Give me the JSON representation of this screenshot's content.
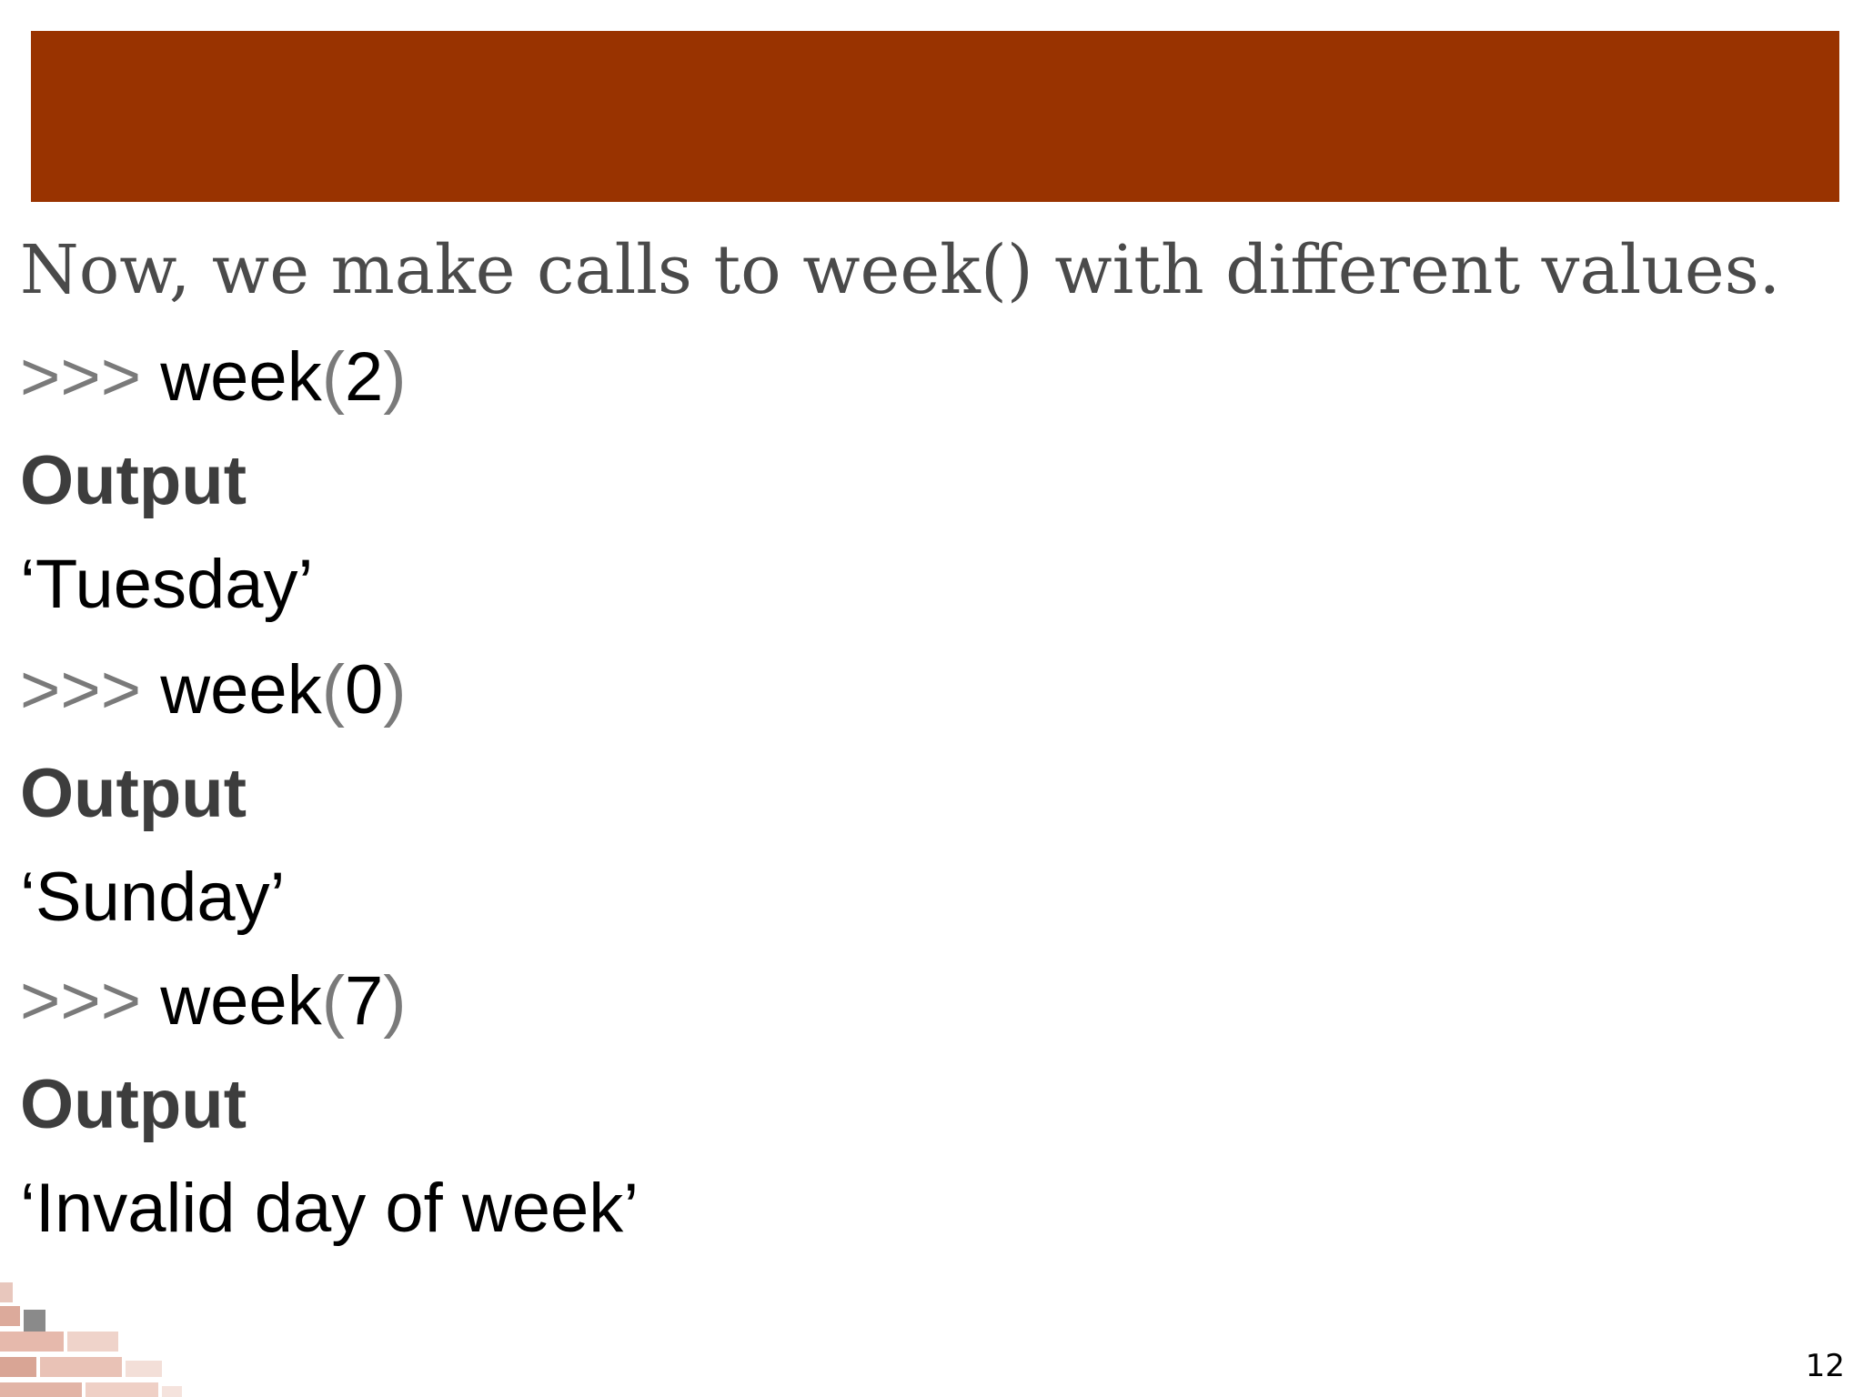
{
  "colors": {
    "title_bar": "#993300",
    "prompt": "#7a7a7a",
    "output_label": "#3d3d3d",
    "text": "#000000"
  },
  "intro": "Now, we make calls to week() with different values.",
  "examples": [
    {
      "prompt": ">>>",
      "call": "week",
      "paren_open": "(",
      "arg": "2",
      "paren_close": ")",
      "output_label": "Output",
      "result": "‘Tuesday’"
    },
    {
      "prompt": ">>>",
      "call": "week",
      "paren_open": "(",
      "arg": "0",
      "paren_close": ")",
      "output_label": "Output",
      "result": "‘Sunday’"
    },
    {
      "prompt": ">>>",
      "call": "week",
      "paren_open": "(",
      "arg": "7",
      "paren_close": ")",
      "output_label": "Output",
      "result": "‘Invalid day of week’"
    }
  ],
  "decoration": {
    "icon": "bricks-icon"
  },
  "page_number": "12"
}
